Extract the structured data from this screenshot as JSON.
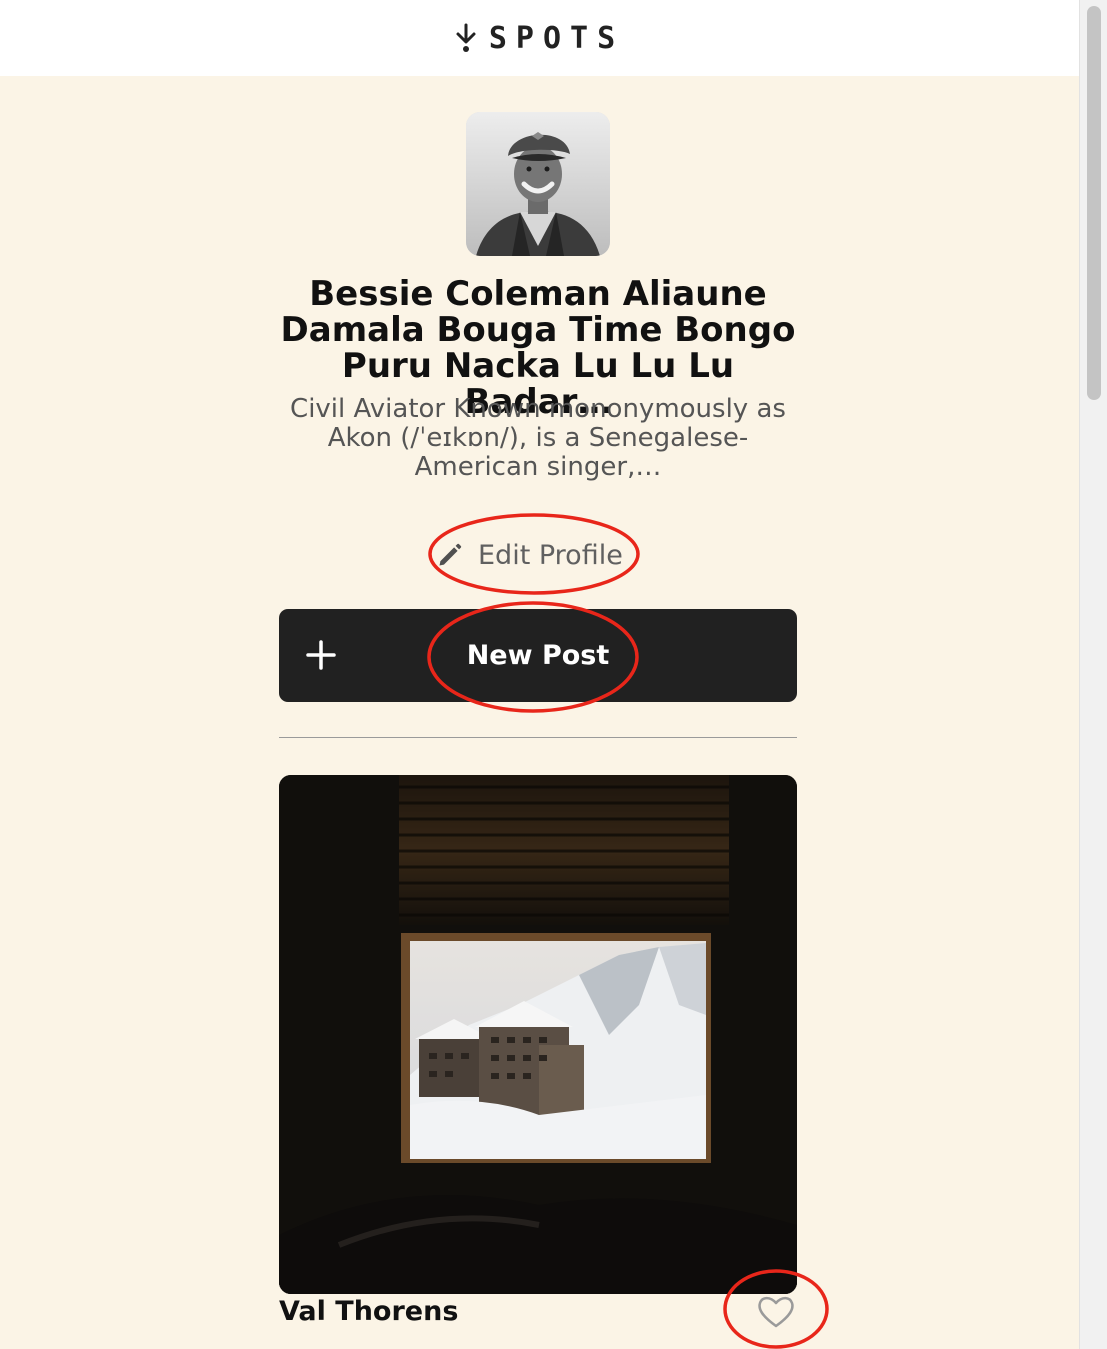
{
  "header": {
    "logo_icon": "arrow-down-icon",
    "logo_text": "SPOTS"
  },
  "profile": {
    "avatar_alt": "profile photo",
    "name": "Bessie Coleman Aliaune Damala Bouga Time Bongo Puru Nacka Lu Lu Lu Badar…",
    "description": "Civil Aviator Known mononymously as Akon (/ˈeɪkɒn/), is a Senegalese-American singer,…",
    "edit_label": "Edit Profile",
    "edit_icon": "pencil-icon"
  },
  "actions": {
    "new_post_label": "New Post",
    "new_post_icon": "plus-icon"
  },
  "cards": [
    {
      "title": "Val Thorens",
      "liked": false,
      "like_icon": "heart-icon"
    }
  ],
  "colors": {
    "background": "#fbf4e6",
    "button": "#212121",
    "annotation": "#e8261a"
  }
}
